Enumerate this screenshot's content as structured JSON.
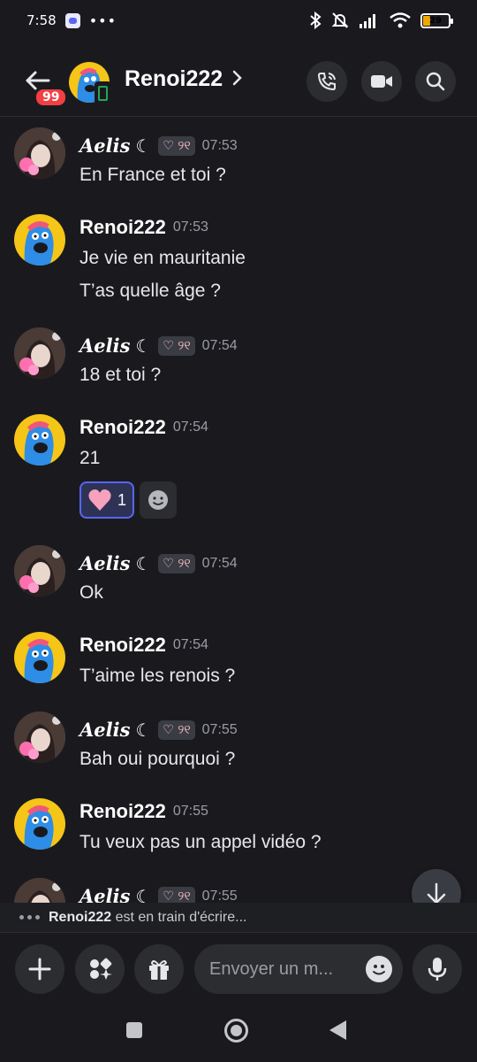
{
  "status_bar": {
    "time": "7:58",
    "more": "•••",
    "battery": "29",
    "battery_level": 0.29
  },
  "header": {
    "unread_badge": "99",
    "title": "Renoi222",
    "chevron": "›",
    "call_icon": "phone-call-icon",
    "video_icon": "video-camera-icon",
    "search_icon": "search-icon"
  },
  "messages": [
    {
      "author": "Aelis",
      "moon": "☾",
      "tag": "♡ ୨୧",
      "time": "07:53",
      "lines": [
        "En France et toi ?"
      ]
    },
    {
      "author": "Renoi222",
      "time": "07:53",
      "lines": [
        "Je vie en mauritanie",
        "T’as quelle âge ?"
      ]
    },
    {
      "author": "Aelis",
      "moon": "☾",
      "tag": "♡ ୨୧",
      "time": "07:54",
      "lines": [
        "18 et toi ?"
      ]
    },
    {
      "author": "Renoi222",
      "time": "07:54",
      "lines": [
        "21"
      ],
      "reaction": {
        "emoji": "heart",
        "count": "1"
      }
    },
    {
      "author": "Aelis",
      "moon": "☾",
      "tag": "♡ ୨୧",
      "time": "07:54",
      "lines": [
        "Ok"
      ]
    },
    {
      "author": "Renoi222",
      "time": "07:54",
      "lines": [
        "T’aime les renois ?"
      ]
    },
    {
      "author": "Aelis",
      "moon": "☾",
      "tag": "♡ ୨୧",
      "time": "07:55",
      "lines": [
        "Bah oui pourquoi ?"
      ]
    },
    {
      "author": "Renoi222",
      "time": "07:55",
      "lines": [
        "Tu veux pas un appel vidéo ?"
      ]
    },
    {
      "author": "Aelis",
      "moon": "☾",
      "tag": "♡ ୨୧",
      "time": "07:55",
      "lines": []
    }
  ],
  "typing": {
    "user": "Renoi222",
    "text": " est en train d'écrire..."
  },
  "composer": {
    "placeholder": "Envoyer un m...",
    "plus_icon": "plus-icon",
    "apps_icon": "apps-icon",
    "gift_icon": "gift-icon",
    "emoji_icon": "emoji-icon",
    "mic_icon": "microphone-icon"
  },
  "colors": {
    "background": "#1a1a1e",
    "accent": "#5865f2",
    "badge": "#f23f43",
    "online_green": "#23a55a"
  }
}
